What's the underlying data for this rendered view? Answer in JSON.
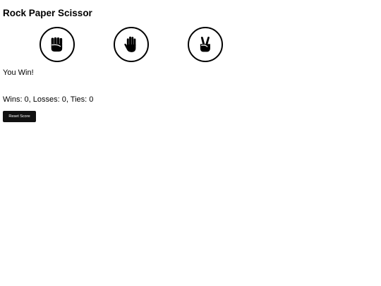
{
  "page": {
    "title": "Rock Paper Scissor"
  },
  "moves": [
    {
      "name": "rock",
      "icon": "rock-hand-icon"
    },
    {
      "name": "paper",
      "icon": "paper-hand-icon"
    },
    {
      "name": "scissors",
      "icon": "scissors-hand-icon"
    }
  ],
  "result": {
    "text": "You Win!"
  },
  "score": {
    "text": "Wins: 0, Losses: 0, Ties: 0",
    "wins": 0,
    "losses": 0,
    "ties": 0
  },
  "controls": {
    "reset_label": "Reset Score"
  },
  "colors": {
    "background": "#ffffff",
    "text": "#000000",
    "button_bg": "#111111",
    "button_text": "#ffffff"
  }
}
